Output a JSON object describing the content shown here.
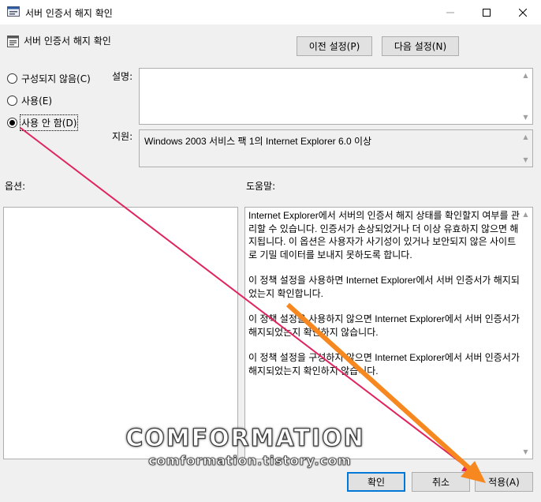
{
  "window": {
    "title": "서버 인증서 해지 확인",
    "icons": {
      "app": "policy-app-icon",
      "minimize": "minimize-icon",
      "maximize": "maximize-icon",
      "close": "close-icon"
    }
  },
  "header": {
    "policy_title": "서버 인증서 해지 확인",
    "prev_button": "이전 설정(P)",
    "next_button": "다음 설정(N)"
  },
  "state": {
    "options": [
      {
        "label": "구성되지 않음(C)",
        "selected": false
      },
      {
        "label": "사용(E)",
        "selected": false
      },
      {
        "label": "사용 안 함(D)",
        "selected": true
      }
    ]
  },
  "comment": {
    "label": "설명:",
    "value": ""
  },
  "supported": {
    "label": "지원:",
    "value": "Windows 2003 서비스 팩 1의 Internet Explorer 6.0 이상"
  },
  "options_section": {
    "label": "옵션:"
  },
  "help_section": {
    "label": "도움말:",
    "paragraphs": [
      "Internet Explorer에서 서버의 인증서 해지 상태를 확인할지 여부를 관리할 수 있습니다. 인증서가 손상되었거나 더 이상 유효하지 않으면 해지됩니다. 이 옵션은 사용자가 사기성이 있거나 보안되지 않은 사이트로 기밀 데이터를 보내지 못하도록 합니다.",
      "이 정책 설정을 사용하면 Internet Explorer에서 서버 인증서가 해지되었는지 확인합니다.",
      "이 정책 설정을 사용하지 않으면 Internet Explorer에서 서버 인증서가 해지되었는지 확인하지 않습니다.",
      "이 정책 설정을 구성하지 않으면 Internet Explorer에서 서버 인증서가 해지되었는지 확인하지 않습니다."
    ]
  },
  "footer": {
    "ok": "확인",
    "cancel": "취소",
    "apply": "적용(A)"
  },
  "watermark": {
    "main": "COMFORMATION",
    "sub": "comformation.tistory.com"
  },
  "colors": {
    "arrow_red": "#e0245e",
    "arrow_orange": "#f6881f",
    "focus_blue": "#0078d7"
  }
}
